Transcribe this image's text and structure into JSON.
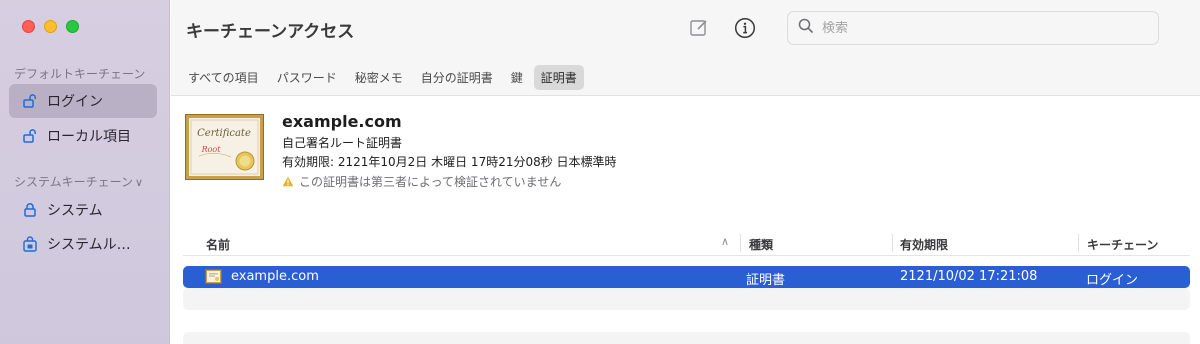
{
  "sidebar": {
    "default_section": "デフォルトキーチェーン",
    "system_section": "システムキーチェーン",
    "system_section_chevron": "∨",
    "items": [
      {
        "label": "ログイン",
        "icon": "unlocked-padlock-icon"
      },
      {
        "label": "ローカル項目",
        "icon": "unlocked-padlock-icon"
      },
      {
        "label": "システム",
        "icon": "locked-padlock-icon"
      },
      {
        "label": "システムル…",
        "icon": "locked-keychain-icon"
      }
    ]
  },
  "toolbar": {
    "title": "キーチェーンアクセス",
    "search_placeholder": "検索",
    "search_value": ""
  },
  "tabs": [
    {
      "label": "すべての項目"
    },
    {
      "label": "パスワード"
    },
    {
      "label": "秘密メモ"
    },
    {
      "label": "自分の証明書"
    },
    {
      "label": "鍵"
    },
    {
      "label": "証明書",
      "active": true
    }
  ],
  "detail": {
    "name": "example.com",
    "kind": "自己署名ルート証明書",
    "expiry": "有効期限: 2121年10月2日 木曜日 17時21分08秒 日本標準時",
    "warning": "この証明書は第三者によって検証されていません",
    "badge_title": "Certificate",
    "badge_sub": "Root"
  },
  "table": {
    "columns": [
      "名前",
      "種類",
      "有効期限",
      "キーチェーン"
    ],
    "sort_indicator": "∧",
    "rows": [
      {
        "name": "example.com",
        "kind": "証明書",
        "expiry": "2121/10/02 17:21:08",
        "keychain": "ログイン",
        "selected": true
      }
    ]
  },
  "colors": {
    "selection": "#2a5fd4",
    "sidebar_bg": "#d7cfe0",
    "accent_link": "#1f6bdc"
  }
}
